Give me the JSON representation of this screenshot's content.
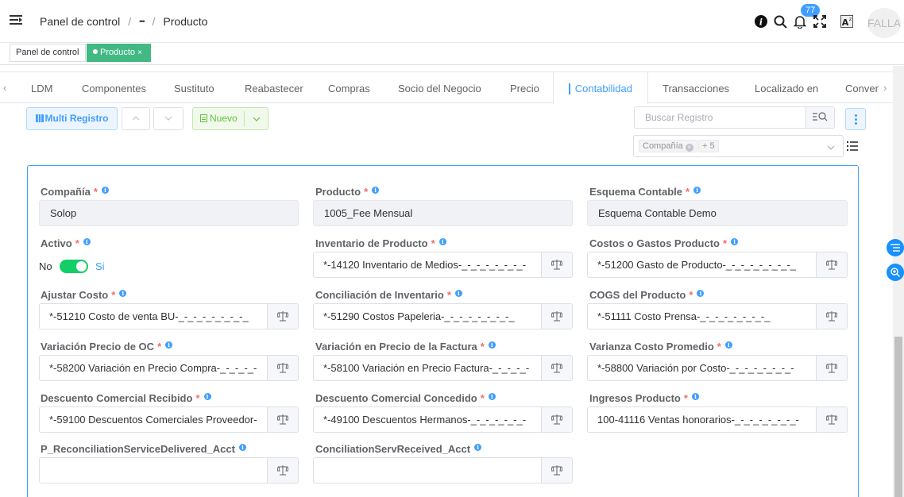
{
  "header": {
    "breadcrumb": [
      "Panel de control",
      "•••",
      "Producto"
    ],
    "notification_count": "77",
    "avatar_text": "FALLA"
  },
  "tags": {
    "home": "Panel de control",
    "active": "Producto",
    "close": "×"
  },
  "tabs": [
    "LDM",
    "Componentes",
    "Sustituto",
    "Reabastecer",
    "Compras",
    "Socio del Negocio",
    "Precio",
    "Contabilidad",
    "Transacciones",
    "Localizado en",
    "Conver"
  ],
  "toolbar": {
    "multi_label": "Multi Registro",
    "new_label": "Nuevo",
    "search_placeholder": "Buscar Registro",
    "filter_chip": "Compañía",
    "filter_more": "+ 5"
  },
  "form": {
    "company_label": "Compañía",
    "company_value": "Solop",
    "product_label": "Producto",
    "product_value": "1005_Fee Mensual",
    "schema_label": "Esquema Contable",
    "schema_value": "Esquema Contable Demo",
    "active_label": "Activo",
    "active_no": "No",
    "active_yes": "Si",
    "inventory_label": "Inventario de Producto",
    "inventory_value": "*-14120 Inventario de Medios-_-_-_-_-_-_-_-",
    "costs_label": "Costos o Gastos Producto",
    "costs_value": "*-51200 Gasto de Producto-_-_-_-_-_-_-_-_",
    "adjust_label": "Ajustar Costo",
    "adjust_value": "*-51210 Costo de venta BU-_-_-_-_-_-_-_-_",
    "reconcile_label": "Conciliación de Inventario",
    "reconcile_value": "*-51290 Costos Papeleria-_-_-_-_-_-_-_-_",
    "cogs_label": "COGS del Producto",
    "cogs_value": "*-51111 Costo Prensa-_-_-_-_-_-_-_-_",
    "po_var_label": "Variación Precio de OC",
    "po_var_value": "*-58200 Variación en Precio Compra-_-_-_-_-",
    "inv_var_label": "Variación en Precio de la Factura",
    "inv_var_value": "*-58100 Variación en Precio Factura-_-_-_-_-",
    "avg_var_label": "Varianza Costo Promedio",
    "avg_var_value": "*-58800 Variación por Costo-_-_-_-_-_-_-_-",
    "disc_rec_label": "Descuento Comercial Recibido",
    "disc_rec_value": "*-59100 Descuentos Comerciales Proveedor-",
    "disc_giv_label": "Descuento Comercial Concedido",
    "disc_giv_value": "*-49100 Descuentos Hermanos-_-_-_-_-_-_-",
    "revenue_label": "Ingresos Producto",
    "revenue_value": "100-41116 Ventas honorarios-_-_-_-_-_-_-_-",
    "svc_del_label": "P_ReconciliationServiceDelivered_Acct",
    "svc_del_value": "",
    "svc_rec_label": "ConciliationServReceived_Acct",
    "svc_rec_value": "",
    "required_mark": "*",
    "info_mark": "i"
  }
}
